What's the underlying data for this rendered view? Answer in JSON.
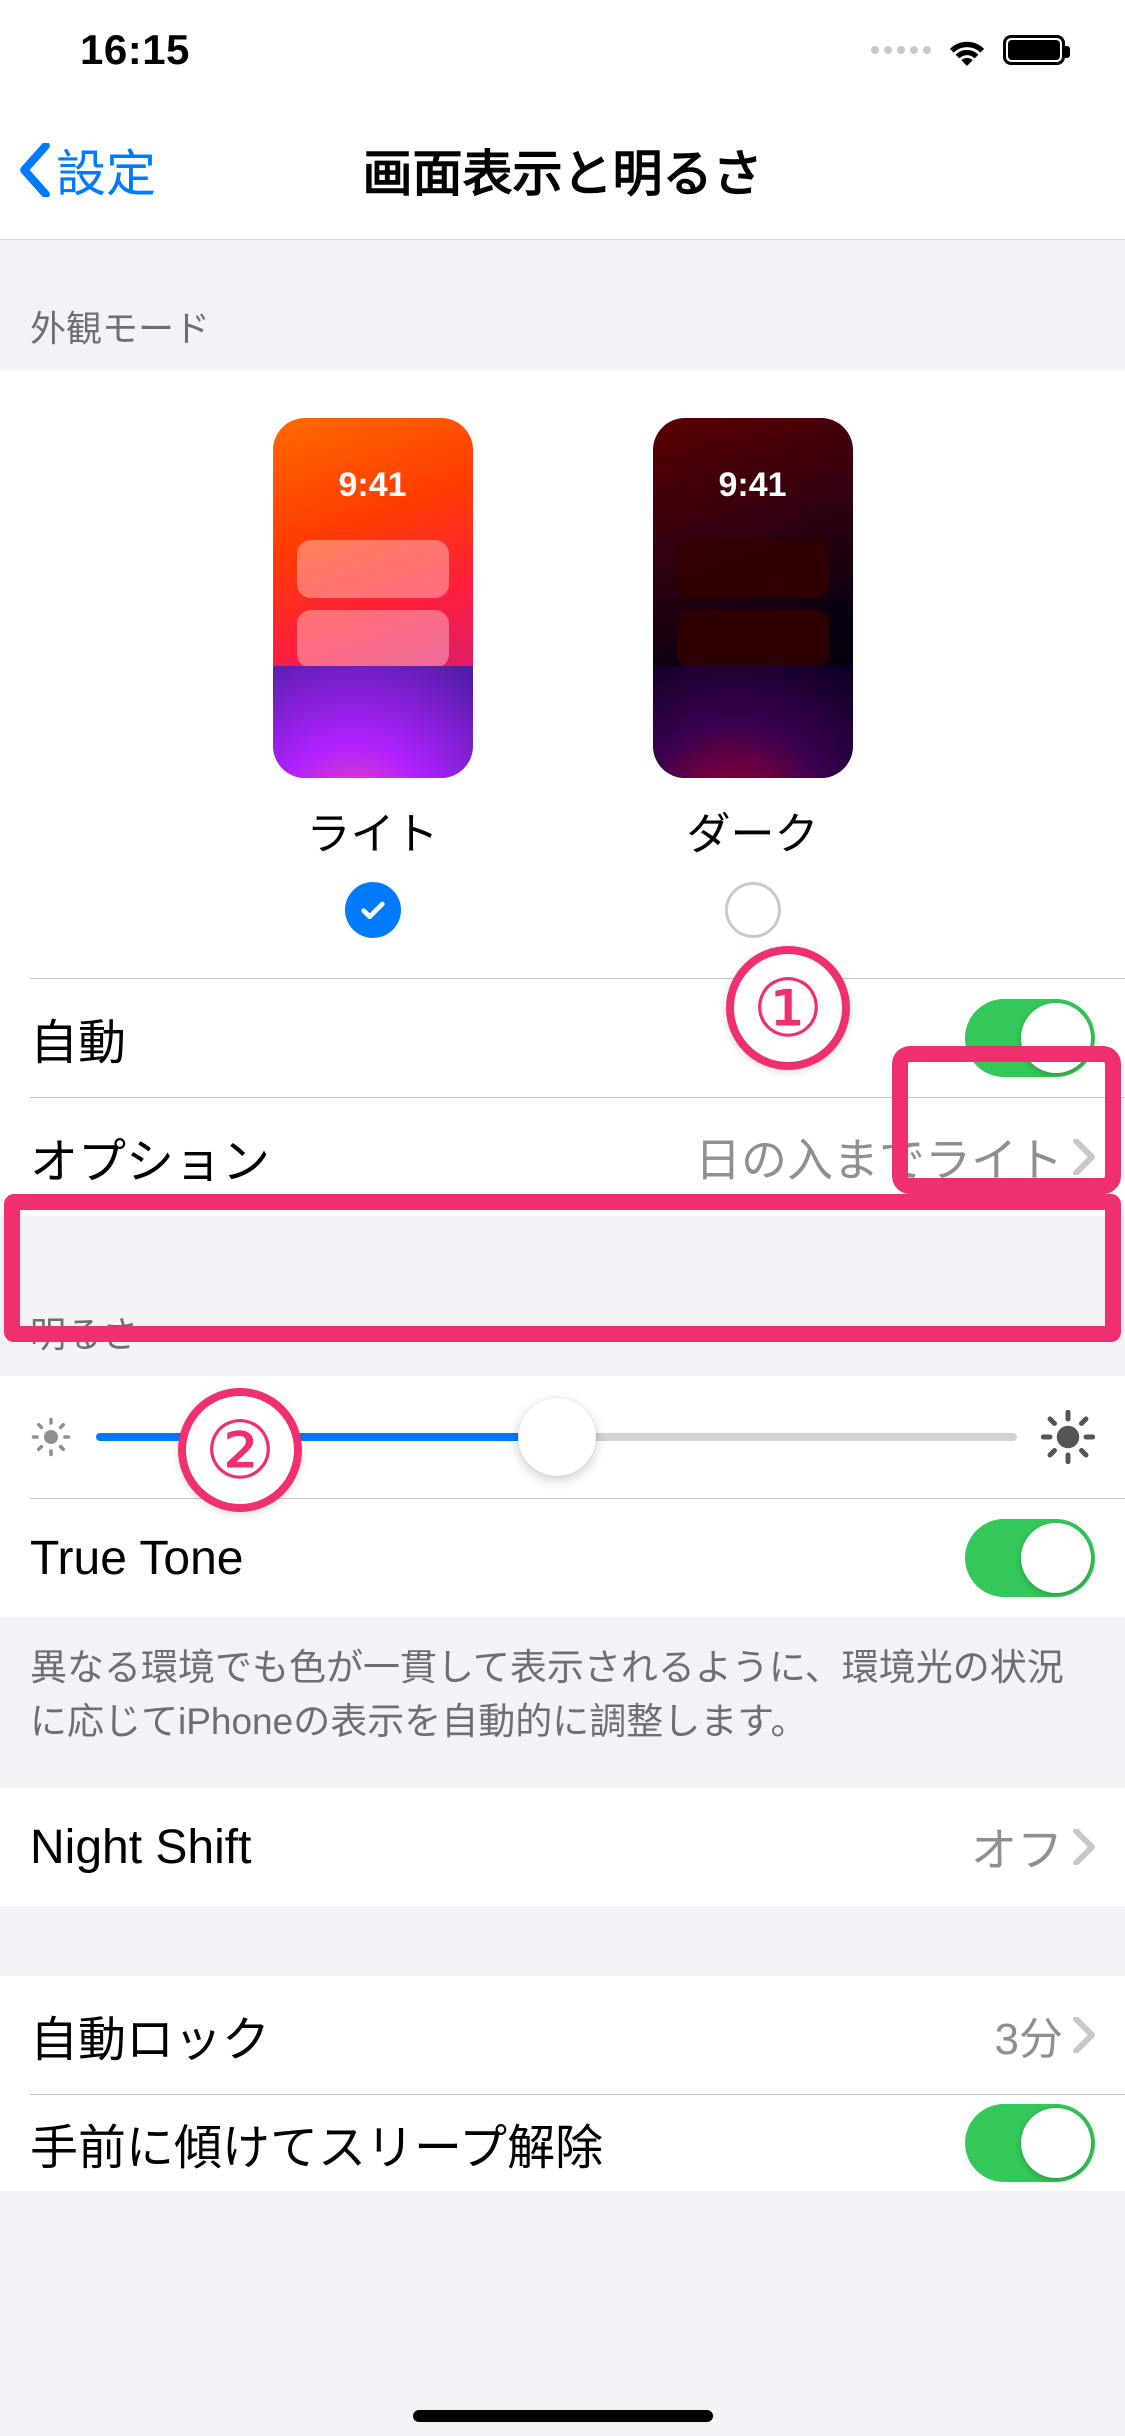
{
  "status": {
    "time": "16:15"
  },
  "nav": {
    "back": "設定",
    "title": "画面表示と明るさ"
  },
  "appearance": {
    "header": "外観モード",
    "thumb_time": "9:41",
    "light_label": "ライト",
    "dark_label": "ダーク",
    "selected": "light"
  },
  "auto": {
    "label": "自動",
    "on": true
  },
  "options": {
    "label": "オプション",
    "value": "日の入までライト"
  },
  "brightness": {
    "header": "明るさ",
    "value_percent": 50
  },
  "truetone": {
    "label": "True Tone",
    "on": true,
    "footer": "異なる環境でも色が一貫して表示されるように、環境光の状況に応じてiPhoneの表示を自動的に調整します。"
  },
  "nightshift": {
    "label": "Night Shift",
    "value": "オフ"
  },
  "autolock": {
    "label": "自動ロック",
    "value": "3分"
  },
  "raise": {
    "label": "手前に傾けてスリープ解除",
    "on": true
  },
  "annotations": {
    "one": "①",
    "two": "②"
  }
}
